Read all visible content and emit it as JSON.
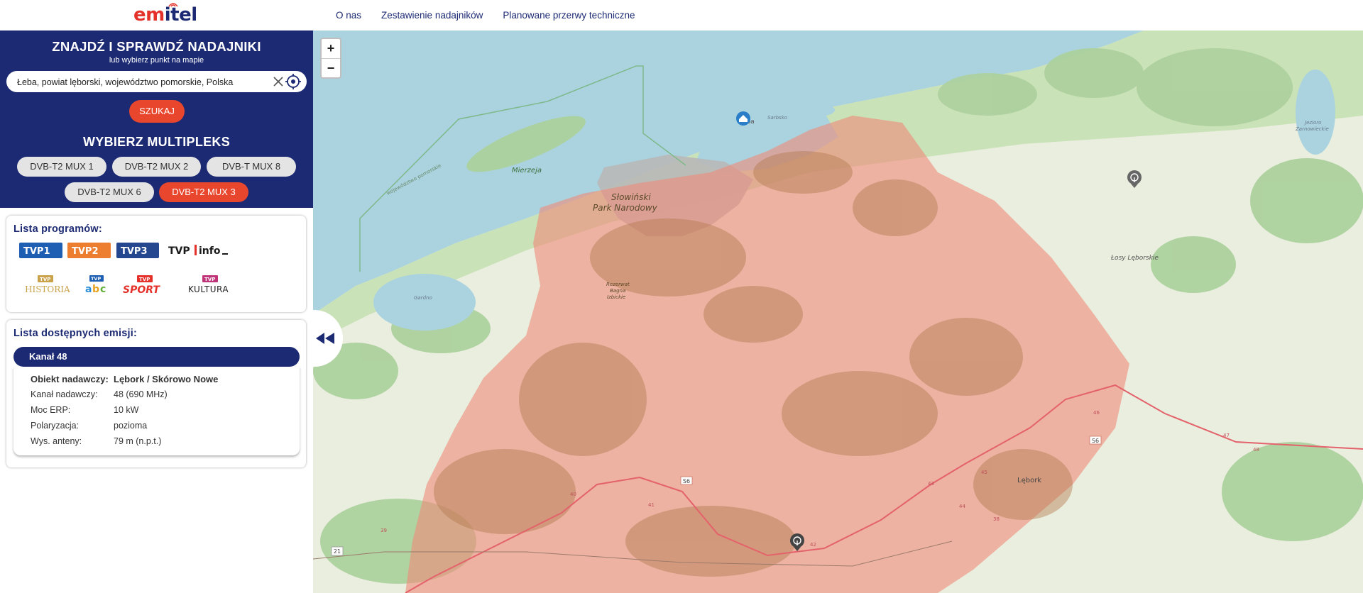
{
  "header": {
    "logo_text": "emitel",
    "nav": [
      "O nas",
      "Zestawienie nadajników",
      "Planowane przerwy techniczne"
    ]
  },
  "search_panel": {
    "title": "ZNAJDŹ I SPRAWDŹ NADAJNIKI",
    "subtitle": "lub wybierz punkt na mapie",
    "search_value": "Łeba, powiat lęborski, województwo pomorskie, Polska",
    "search_button": "SZUKAJ",
    "multiplex_title": "WYBIERZ MULTIPLEKS",
    "multiplexes": [
      "DVB-T2 MUX 1",
      "DVB-T2 MUX 2",
      "DVB-T MUX 8",
      "DVB-T2 MUX 6",
      "DVB-T2 MUX 3"
    ],
    "active_multiplex": "DVB-T2 MUX 3"
  },
  "programs": {
    "title": "Lista programów:",
    "logos": [
      "TVP1",
      "TVP2",
      "TVP3",
      "TVP info",
      "TVP HISTORIA",
      "TVP abc",
      "TVP SPORT",
      "TVP KULTURA"
    ]
  },
  "emissions": {
    "title": "Lista dostępnych emisji:",
    "channel": "Kanał 48",
    "details": {
      "object_label": "Obiekt nadawczy:",
      "object_value": "Lębork / Skórowo Nowe",
      "channel_label": "Kanał nadawczy:",
      "channel_value": "48 (690 MHz)",
      "erp_label": "Moc ERP:",
      "erp_value": "10 kW",
      "polar_label": "Polaryzacja:",
      "polar_value": "pozioma",
      "height_label": "Wys. anteny:",
      "height_value": "79 m (n.p.t.)"
    }
  },
  "map": {
    "zoom_in": "+",
    "zoom_out": "−",
    "labels": {
      "leba": "Łeba",
      "sarbsko": "Sarbsko",
      "mierzeja": "Mierzeja",
      "park1": "Słowiński",
      "park2": "Park Narodowy",
      "rezerwat1": "Rezerwat",
      "rezerwat2": "Bagna",
      "rezerwat3": "Izbickie",
      "gardno": "Gardno",
      "losy": "Łosy Lęborskie",
      "zarnowieckie1": "Jezioro",
      "zarnowieckie2": "Żarnowieckie",
      "lebork": "Lębork",
      "road_s6": "S6",
      "road_21": "21",
      "wojewodztwo": "województwo pomorskie",
      "km_40": "40",
      "km_41": "41",
      "km_42": "42",
      "km_43": "43",
      "km_44": "44",
      "km_45": "45",
      "km_46": "46",
      "km_47": "47",
      "km_48": "48",
      "km_39": "39",
      "km_38": "38"
    },
    "coverage_color": "#f08a78",
    "sea_color": "#aad3df",
    "land_color": "#e9eede",
    "forest_color": "#add19e"
  },
  "colors": {
    "primary": "#1c2a73",
    "accent": "#e8472d"
  }
}
